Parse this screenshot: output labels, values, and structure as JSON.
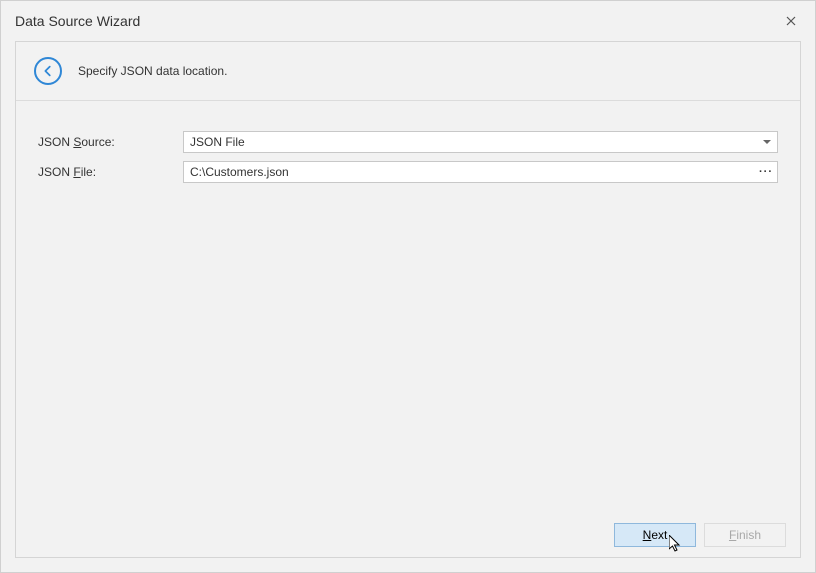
{
  "window": {
    "title": "Data Source Wizard"
  },
  "header": {
    "instruction": "Specify JSON data location."
  },
  "form": {
    "source_label_pre": "JSON ",
    "source_label_ul": "S",
    "source_label_post": "ource:",
    "source_value": "JSON File",
    "file_label_pre": "JSON ",
    "file_label_ul": "F",
    "file_label_post": "ile:",
    "file_value": "C:\\Customers.json",
    "browse_glyph": "···"
  },
  "footer": {
    "next_ul": "N",
    "next_rest": "ext",
    "finish_ul": "F",
    "finish_rest": "inish"
  }
}
